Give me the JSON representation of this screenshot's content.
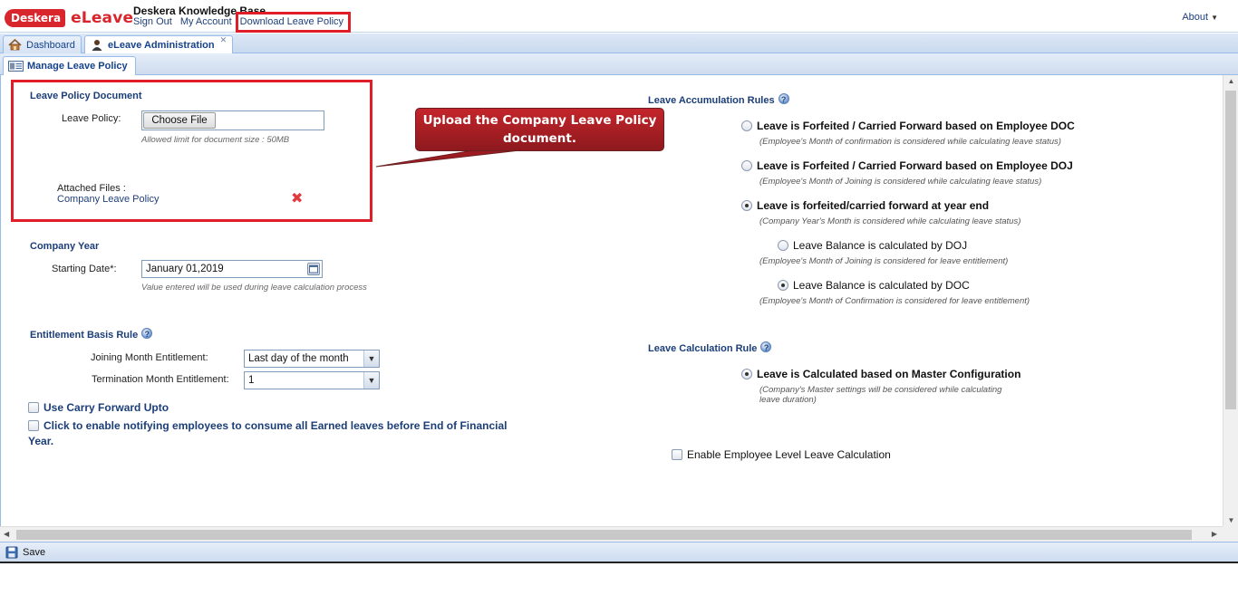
{
  "header": {
    "logo_badge": "Deskera",
    "logo_word": "eLeave",
    "kb_title": "Deskera Knowledge Base",
    "links": [
      "Sign Out",
      "My Account",
      "Download Leave Policy"
    ],
    "about": "About",
    "about_arrow": "▼"
  },
  "tabs": [
    {
      "label": "Dashboard"
    },
    {
      "label": "eLeave Administration",
      "close": "✕"
    }
  ],
  "subtab": {
    "label": "Manage Leave Policy"
  },
  "policy_doc": {
    "title": "Leave Policy Document",
    "field_label": "Leave Policy:",
    "button": "Choose File",
    "hint": "Allowed limit for document size : 50MB",
    "attached_label": "Attached Files :",
    "attached_file": "Company Leave Policy",
    "delete_glyph": "✖"
  },
  "callout": {
    "text": "Upload  the Company Leave Policy document."
  },
  "company_year": {
    "title": "Company Year",
    "label": "Starting Date*:",
    "value": "January 01,2019",
    "hint": "Value entered will be used during leave calculation process"
  },
  "entitlement": {
    "title": "Entitlement Basis Rule",
    "help": "?",
    "joining_label": "Joining Month Entitlement:",
    "joining_value": "Last day of the month",
    "termination_label": "Termination Month Entitlement:",
    "termination_value": "1",
    "trigger_glyph": "▼"
  },
  "checks": {
    "carry_forward": "Use Carry Forward Upto",
    "notify_line1": "Click to enable notifying employees to consume all Earned leaves before End of Financial",
    "notify_line2": "Year."
  },
  "accumulation": {
    "title": "Leave Accumulation Rules",
    "help": "?",
    "options": [
      {
        "label": "Leave is Forfeited / Carried Forward based on Employee DOC",
        "hint": "(Employee's Month of confirmation is considered while calculating leave status)",
        "selected": false
      },
      {
        "label": "Leave is Forfeited / Carried Forward based on Employee DOJ",
        "hint": "(Employee's Month of Joining is considered while calculating leave status)",
        "selected": false
      },
      {
        "label": "Leave is forfeited/carried forward at year end",
        "hint": "(Company Year's Month is considered while calculating leave status)",
        "selected": true
      }
    ],
    "sub_options": [
      {
        "label": "Leave Balance is calculated by DOJ",
        "hint": "(Employee's Month of Joining is considered for leave entitlement)",
        "selected": false
      },
      {
        "label": "Leave Balance is calculated by DOC",
        "hint": "(Employee's Month of Confirmation is considered for leave entitlement)",
        "selected": true
      }
    ]
  },
  "calculation": {
    "title": "Leave Calculation Rule",
    "help": "?",
    "option": "Leave is Calculated based on Master Configuration",
    "hint_line1": "(Company's Master settings will be considered while calculating",
    "hint_line2": "leave duration)",
    "employee_level": "Enable Employee Level Leave Calculation"
  },
  "scroll": {
    "up": "▲",
    "down": "▼",
    "left": "◀",
    "right": "▶"
  },
  "footer": {
    "save": "Save"
  },
  "colors": {
    "accent_red": "#e01e2a",
    "link_blue": "#1f3f7a",
    "title_blue": "#1c3e78",
    "callout_red": "#c3252b"
  }
}
